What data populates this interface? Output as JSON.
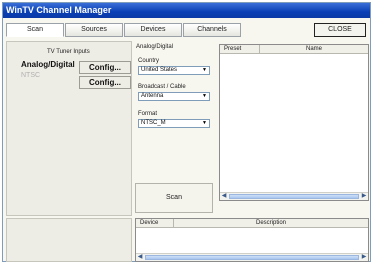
{
  "window": {
    "title": "WinTV Channel Manager"
  },
  "tabs": [
    {
      "label": "Scan"
    },
    {
      "label": "Sources"
    },
    {
      "label": "Devices"
    },
    {
      "label": "Channels"
    }
  ],
  "close_label": "CLOSE",
  "tuner": {
    "title": "TV Tuner Inputs",
    "inputs": [
      {
        "label": "Analog/Digital",
        "config_label": "Config..."
      },
      {
        "label": "NTSC",
        "config_label": "Config..."
      }
    ]
  },
  "settings": {
    "section_title": "Analog/Digital",
    "country_label": "Country",
    "country_value": "United States",
    "broadcast_label": "Broadcast / Cable",
    "broadcast_value": "Antenna",
    "format_label": "Format",
    "format_value": "NTSC_M"
  },
  "scan_label": "Scan",
  "preset_list": {
    "columns": [
      "Preset",
      "Name"
    ]
  },
  "device_list": {
    "columns": [
      "Device",
      "Description"
    ]
  }
}
